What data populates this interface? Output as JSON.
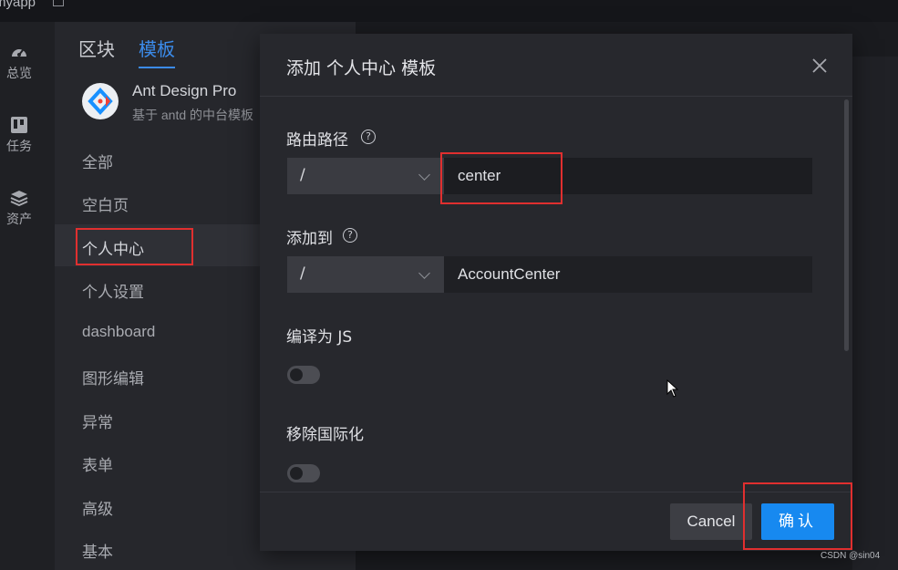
{
  "app": {
    "title": "myapp"
  },
  "rail": {
    "items": [
      {
        "label": "总览",
        "icon": "dashboard-icon"
      },
      {
        "label": "任务",
        "icon": "trello-icon"
      },
      {
        "label": "资产",
        "icon": "layers-icon"
      }
    ]
  },
  "panel": {
    "tabs": [
      {
        "label": "区块"
      },
      {
        "label": "模板",
        "active": true
      }
    ],
    "template": {
      "name": "Ant Design Pro",
      "description": "基于 antd 的中台模板"
    },
    "categories": [
      {
        "label": "全部"
      },
      {
        "label": "空白页"
      },
      {
        "label": "个人中心",
        "selected": true
      },
      {
        "label": "个人设置"
      },
      {
        "label": "dashboard"
      },
      {
        "label": "图形编辑"
      },
      {
        "label": "异常"
      },
      {
        "label": "表单"
      },
      {
        "label": "高级"
      },
      {
        "label": "基本"
      }
    ]
  },
  "modal": {
    "title": "添加 个人中心 模板",
    "fields": {
      "route": {
        "label": "路由路径",
        "prefix": "/",
        "value": "center"
      },
      "add_to": {
        "label": "添加到",
        "prefix": "/",
        "value": "AccountCenter"
      },
      "compile_js": {
        "label": "编译为 JS",
        "checked": false
      },
      "remove_i18n": {
        "label": "移除国际化",
        "checked": false
      }
    },
    "cancel_label": "Cancel",
    "confirm_label": "确认"
  },
  "watermark": "CSDN @sin04",
  "colors": {
    "accent": "#1789f0",
    "highlight_box": "#e02f2f",
    "tab_active": "#3b8bea"
  }
}
